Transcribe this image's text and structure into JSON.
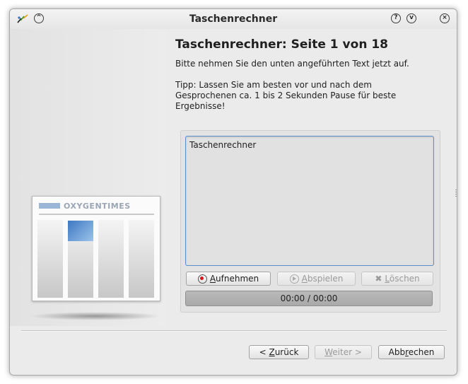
{
  "window": {
    "title": "Taschenrechner",
    "titlebar_buttons": {
      "keep_above_icon": "chevron-up-circle-icon",
      "help_icon": "question-circle-icon",
      "minimize_icon": "chevron-down-circle-icon",
      "close_icon": "close-circle-icon"
    }
  },
  "sidebar": {
    "illustration_brand": "OXYGENTIMES"
  },
  "page": {
    "heading": "Taschenrechner: Seite 1 von 18",
    "intro": "Bitte nehmen Sie den unten angeführten Text jetzt auf.",
    "tip": "Tipp: Lassen Sie am besten vor und nach dem Gesprochenen ca. 1 bis 2 Sekunden Pause für beste Ergebnisse!"
  },
  "recording": {
    "prompt_text": "Taschenrechner",
    "record_label_mnemonic": "A",
    "record_label_rest": "ufnehmen",
    "play_label_mnemonic": "A",
    "play_label_rest": "bspielen",
    "delete_label_mnemonic": "L",
    "delete_label_rest": "öschen",
    "time_display": "00:00 / 00:00",
    "record_dot_color": "#d2161a"
  },
  "footer": {
    "back_label_prefix": "< ",
    "back_label_mnemonic": "Z",
    "back_label_rest": "urück",
    "next_label_mnemonic": "W",
    "next_label_rest": "eiter >",
    "cancel_label_prefix": "Abb",
    "cancel_label_mnemonic": "r",
    "cancel_label_rest": "echen"
  }
}
